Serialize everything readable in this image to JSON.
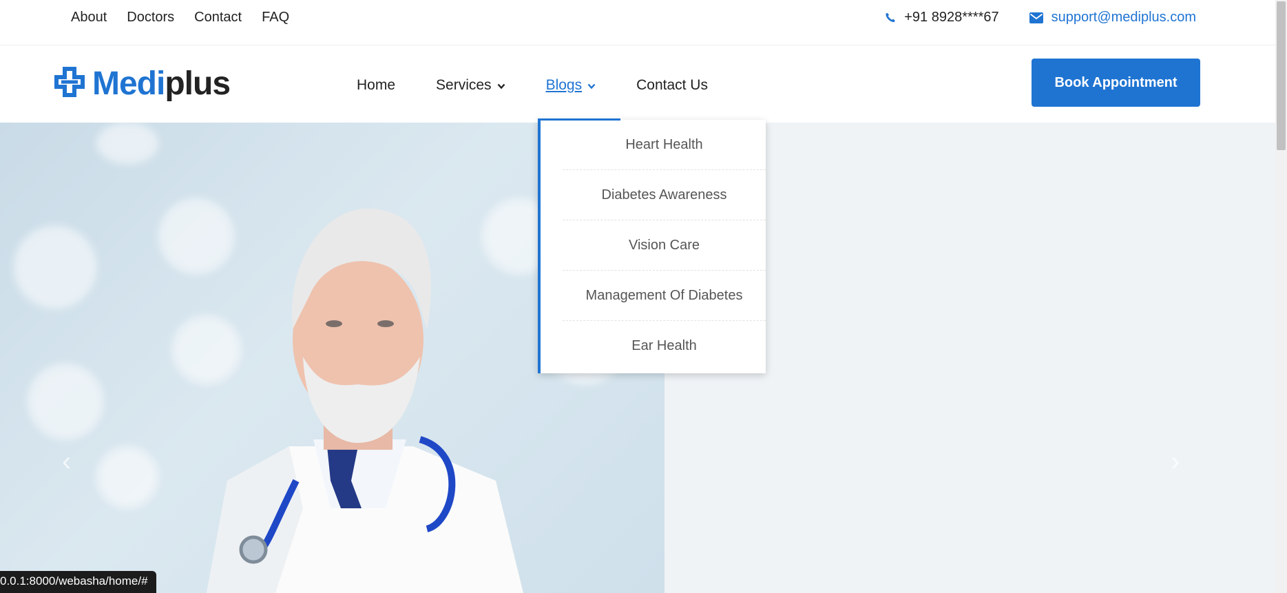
{
  "topbar": {
    "links": [
      "About",
      "Doctors",
      "Contact",
      "FAQ"
    ],
    "phone": "+91 8928****67",
    "email": "support@mediplus.com"
  },
  "header": {
    "logo_medi": "Medi",
    "logo_plus": "plus",
    "nav": {
      "home": "Home",
      "services": "Services",
      "blogs": "Blogs",
      "contact": "Contact Us"
    },
    "book_button": "Book Appointment"
  },
  "dropdown": {
    "items": [
      "Heart Health",
      "Diabetes Awareness",
      "Vision Care",
      "Management Of Diabetes",
      "Ear Health"
    ]
  },
  "status_url": "0.0.1:8000/webasha/home/#",
  "colors": {
    "brand": "#1f74d2",
    "hero_bg": "#eff3f6"
  },
  "icons": {
    "phone": "phone-icon",
    "email": "envelope-icon",
    "chevron": "chevron-down-icon",
    "logo": "medical-cross-icon",
    "arrows": [
      "chevron-left-icon",
      "chevron-right-icon"
    ]
  }
}
